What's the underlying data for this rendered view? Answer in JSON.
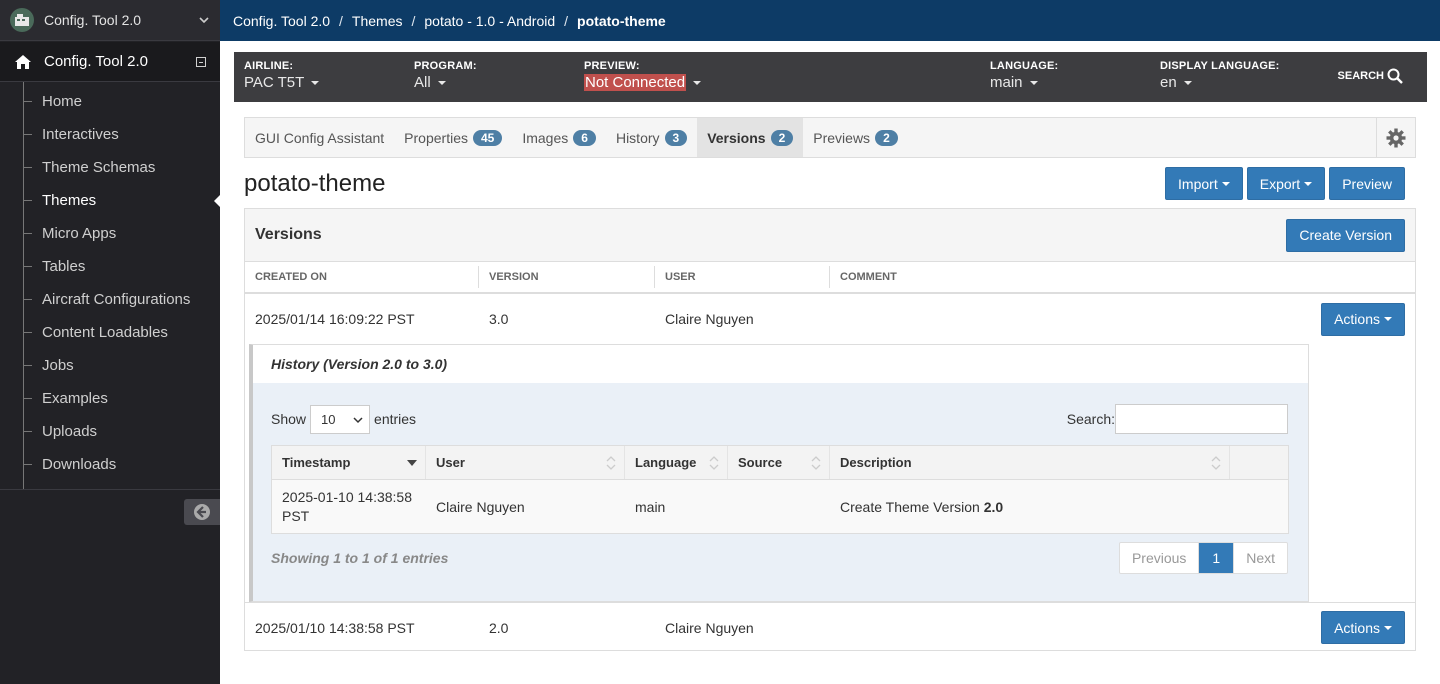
{
  "sidebar": {
    "app_name": "Config. Tool 2.0",
    "section_title": "Config. Tool 2.0",
    "items": [
      {
        "label": "Home"
      },
      {
        "label": "Interactives"
      },
      {
        "label": "Theme Schemas"
      },
      {
        "label": "Themes"
      },
      {
        "label": "Micro Apps"
      },
      {
        "label": "Tables"
      },
      {
        "label": "Aircraft Configurations"
      },
      {
        "label": "Content Loadables"
      },
      {
        "label": "Jobs"
      },
      {
        "label": "Examples"
      },
      {
        "label": "Uploads"
      },
      {
        "label": "Downloads"
      }
    ],
    "active_item": "Themes"
  },
  "breadcrumb": [
    "Config. Tool 2.0",
    "Themes",
    "potato - 1.0 - Android",
    "potato-theme"
  ],
  "filters": {
    "airline": {
      "label": "AIRLINE:",
      "value": "PAC T5T"
    },
    "program": {
      "label": "PROGRAM:",
      "value": "All"
    },
    "preview": {
      "label": "PREVIEW:",
      "value": "Not Connected"
    },
    "language": {
      "label": "LANGUAGE:",
      "value": "main"
    },
    "display_language": {
      "label": "DISPLAY LANGUAGE:",
      "value": "en"
    },
    "search_label": "SEARCH"
  },
  "tabs": [
    {
      "label": "GUI Config Assistant",
      "count": null
    },
    {
      "label": "Properties",
      "count": "45"
    },
    {
      "label": "Images",
      "count": "6"
    },
    {
      "label": "History",
      "count": "3"
    },
    {
      "label": "Versions",
      "count": "2"
    },
    {
      "label": "Previews",
      "count": "2"
    }
  ],
  "page_title": "potato-theme",
  "buttons": {
    "import": "Import",
    "export": "Export",
    "preview": "Preview"
  },
  "versions_panel": {
    "title": "Versions",
    "create_label": "Create Version",
    "columns": [
      "CREATED ON",
      "VERSION",
      "USER",
      "COMMENT"
    ],
    "rows": [
      {
        "created_on": "2025/01/14 16:09:22 PST",
        "version": "3.0",
        "user": "Claire Nguyen",
        "comment": "",
        "action": "Actions"
      },
      {
        "created_on": "2025/01/10 14:38:58 PST",
        "version": "2.0",
        "user": "Claire Nguyen",
        "comment": "",
        "action": "Actions"
      }
    ]
  },
  "history": {
    "title": "History (Version 2.0 to 3.0)",
    "show_label": "Show",
    "page_size": "10",
    "entries_label": "entries",
    "search_label": "Search:",
    "columns": [
      "Timestamp",
      "User",
      "Language",
      "Source",
      "Description"
    ],
    "rows": [
      {
        "timestamp_line1": "2025-01-10 14:38:58",
        "timestamp_line2": "PST",
        "user": "Claire Nguyen",
        "language": "main",
        "source": "",
        "description_prefix": "Create Theme Version",
        "description_version": "2.0"
      }
    ],
    "info": "Showing 1 to 1 of 1 entries",
    "pager": {
      "previous": "Previous",
      "page": "1",
      "next": "Next"
    }
  }
}
